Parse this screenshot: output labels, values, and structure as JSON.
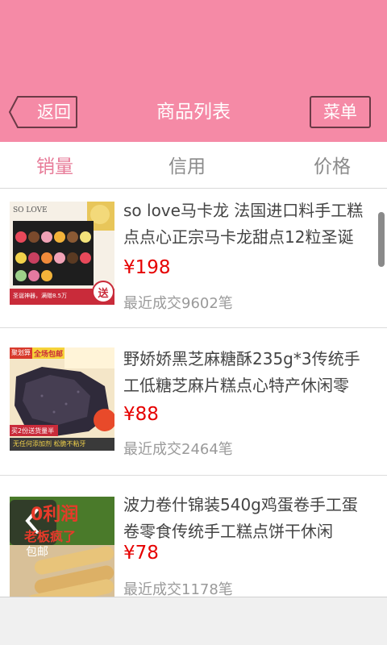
{
  "header": {
    "back_label": "返回",
    "title": "商品列表",
    "menu_label": "菜单",
    "background_color": "#f58aa6"
  },
  "tabs": [
    {
      "label": "销量",
      "active": true
    },
    {
      "label": "信用",
      "active": false
    },
    {
      "label": "价格",
      "active": false
    }
  ],
  "products": [
    {
      "title": "so love马卡龙 法国进口料手工糕点点心正宗马卡龙甜点12粒圣诞",
      "price": "¥198",
      "sold": "最近成交9602笔",
      "thumb": {
        "brand": "SO LOVE",
        "badge": "送",
        "caption": "圣诞神器，满赠8.5万"
      }
    },
    {
      "title": "野娇娇黑芝麻糖酥235g*3传统手工低糖芝麻片糕点心特产休闲零",
      "price": "¥88",
      "sold": "最近成交2464笔",
      "thumb": {
        "tag": "聚划算",
        "banner": "全场包邮",
        "caption": "无任何添加剂 松脆不粘牙",
        "promo": "买2份送货量半"
      }
    },
    {
      "title": "波力卷什锦装540g鸡蛋卷手工蛋卷零食传统手工糕点饼干休闲",
      "price": "¥78",
      "sold": "最近成交1178笔",
      "thumb": {
        "text1": "0利润",
        "text2": "老板疯了",
        "text3": "包邮"
      }
    }
  ],
  "colors": {
    "accent": "#e77b98",
    "price": "#e60000"
  }
}
